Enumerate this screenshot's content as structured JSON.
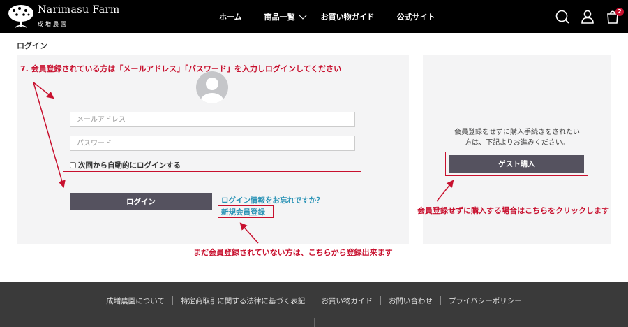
{
  "header": {
    "logo_title": "Narimasu Farm",
    "logo_subtitle": "成増農園",
    "nav": [
      {
        "label": "ホーム"
      },
      {
        "label": "商品一覧"
      },
      {
        "label": "お買い物ガイド"
      },
      {
        "label": "公式サイト"
      }
    ],
    "cart_count": "2",
    "icons": [
      "search-icon",
      "user-icon",
      "cart-icon"
    ]
  },
  "page": {
    "title": "ログイン"
  },
  "login": {
    "email_placeholder": "メールアドレス",
    "password_placeholder": "パスワード",
    "remember_label": "次回から自動的にログインする",
    "login_button": "ログイン",
    "forgot_link": "ログイン情報をお忘れですか？",
    "register_link": "新規会員登録"
  },
  "guest": {
    "text_line1": "会員登録をせずに購入手続きをされたい",
    "text_line2": "方は、下記よりお進みください。",
    "button": "ゲスト購入"
  },
  "annotations": {
    "step": "7. 会員登録されている方は「メールアドレス」「パスワード」を入力しログインしてください",
    "register_note": "まだ会員登録されていない方は、こちらから登録出来ます",
    "guest_note": "会員登録せずに購入する場合はこちらをクリックします"
  },
  "footer": {
    "links": [
      {
        "label": "成増農園について"
      },
      {
        "label": "特定商取引に関する法律に基づく表記"
      },
      {
        "label": "お買い物ガイド"
      },
      {
        "label": "お問い合わせ"
      },
      {
        "label": "プライバシーポリシー"
      }
    ]
  },
  "colors": {
    "header_bg": "#000000",
    "panel_bg": "#f4f4f5",
    "button_bg": "#55525f",
    "link": "#2a93b6",
    "annotation": "#c8102e",
    "footer_bg": "#3a3a3a"
  }
}
